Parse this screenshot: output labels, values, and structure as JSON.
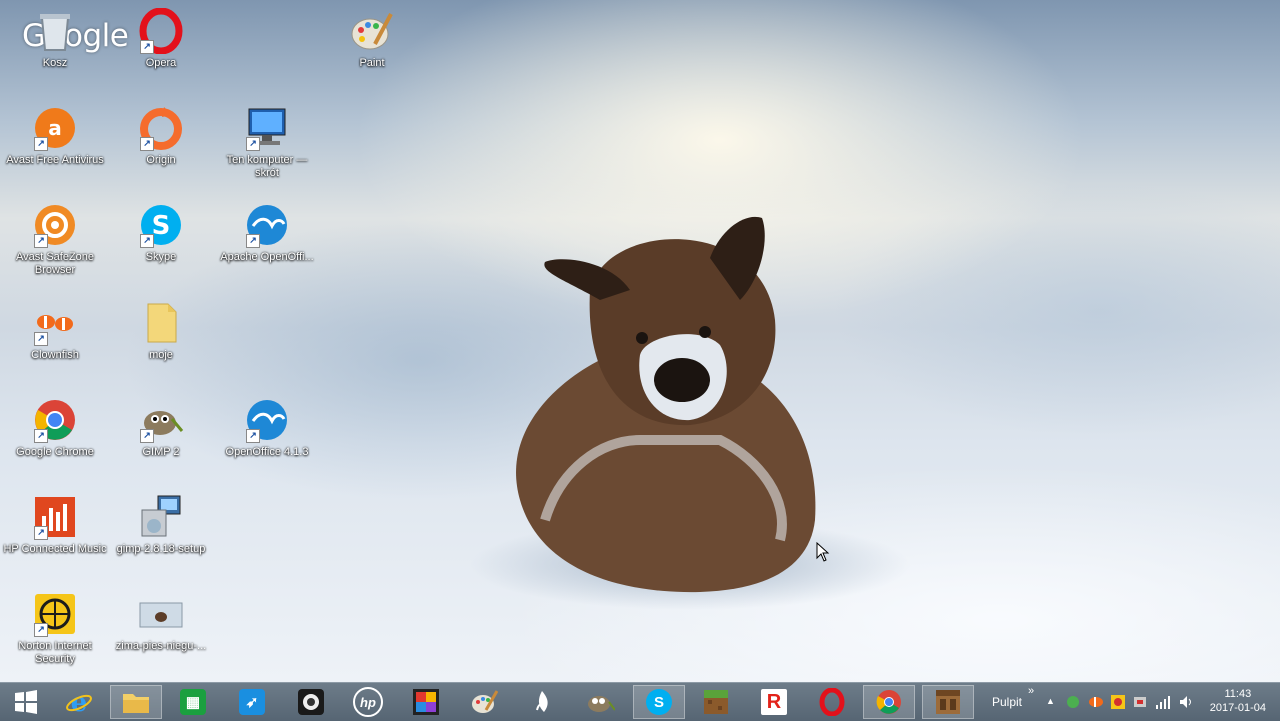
{
  "desktop": {
    "watermark": "Google",
    "icons": [
      {
        "label": "Kosz",
        "icon": "recycle-bin-icon"
      },
      {
        "label": "Opera",
        "icon": "opera-icon"
      },
      {
        "label": "Paint",
        "icon": "paint-icon"
      },
      {
        "label": "Avast Free Antivirus",
        "icon": "avast-icon"
      },
      {
        "label": "Origin",
        "icon": "origin-icon"
      },
      {
        "label": "Ten komputer — skrót",
        "icon": "computer-icon"
      },
      {
        "label": "Avast SafeZone Browser",
        "icon": "safezone-icon"
      },
      {
        "label": "Skype",
        "icon": "skype-icon"
      },
      {
        "label": "Apache OpenOffi...",
        "icon": "openoffice-icon"
      },
      {
        "label": "Clownfish",
        "icon": "clownfish-icon"
      },
      {
        "label": "moje",
        "icon": "folder-icon"
      },
      {
        "label": "Google Chrome",
        "icon": "chrome-icon"
      },
      {
        "label": "GIMP 2",
        "icon": "gimp-icon"
      },
      {
        "label": "OpenOffice 4.1.3",
        "icon": "openoffice-icon"
      },
      {
        "label": "HP Connected Music",
        "icon": "hp-music-icon"
      },
      {
        "label": "gimp-2.8.18-setup",
        "icon": "installer-icon"
      },
      {
        "label": "Norton Internet Security",
        "icon": "norton-icon"
      },
      {
        "label": "zima-pies-niegu-...",
        "icon": "image-file-icon"
      }
    ]
  },
  "taskbar": {
    "pinned": [
      {
        "name": "start-button",
        "icon": "windows-icon"
      },
      {
        "name": "internet-explorer",
        "icon": "ie-icon"
      },
      {
        "name": "file-explorer",
        "icon": "folder-icon"
      },
      {
        "name": "store",
        "icon": "store-icon"
      },
      {
        "name": "rocket-app",
        "icon": "rocket-icon"
      },
      {
        "name": "media-app",
        "icon": "camera-icon"
      },
      {
        "name": "hp-app",
        "icon": "hp-icon",
        "text": "hp"
      },
      {
        "name": "photo-app",
        "icon": "photo-icon"
      },
      {
        "name": "paint",
        "icon": "paint-icon"
      },
      {
        "name": "inkscape-app",
        "icon": "ink-icon"
      },
      {
        "name": "gimp",
        "icon": "gimp-icon"
      },
      {
        "name": "skype",
        "icon": "skype-icon",
        "text": "S"
      },
      {
        "name": "minecraft",
        "icon": "minecraft-icon"
      },
      {
        "name": "roblox",
        "icon": "roblox-icon",
        "text": "R"
      },
      {
        "name": "opera",
        "icon": "opera-icon"
      },
      {
        "name": "chrome",
        "icon": "chrome-icon"
      },
      {
        "name": "crafting",
        "icon": "crafting-table-icon"
      }
    ],
    "toolbar_label": "Pulpit",
    "toolbar_chevron": "»",
    "tray_expand": "▲",
    "clock_time": "11:43",
    "clock_date": "2017-01-04"
  }
}
